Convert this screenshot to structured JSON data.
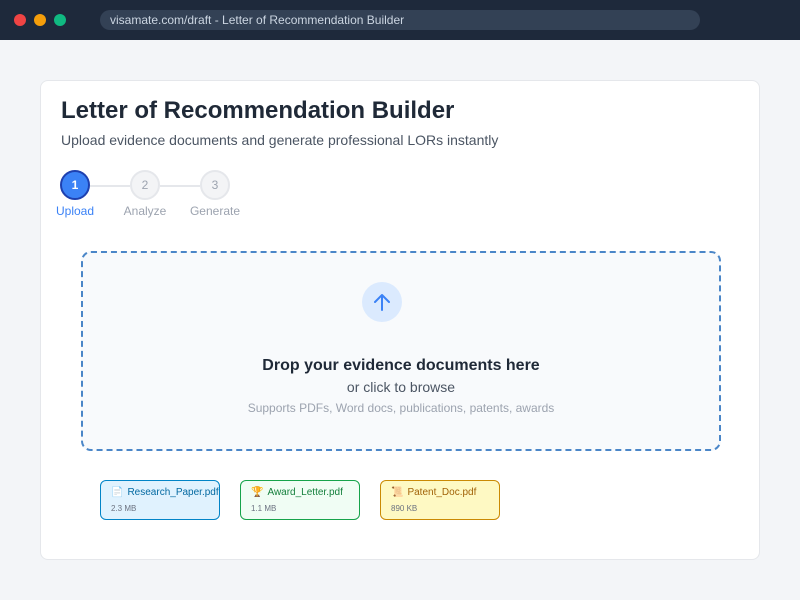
{
  "window": {
    "url": "visamate.com/draft - Letter of Recommendation Builder"
  },
  "page": {
    "title": "Letter of Recommendation Builder",
    "subtitle": "Upload evidence documents and generate professional LORs instantly"
  },
  "stepper": {
    "steps": [
      {
        "number": "1",
        "label": "Upload",
        "active": true
      },
      {
        "number": "2",
        "label": "Analyze",
        "active": false
      },
      {
        "number": "3",
        "label": "Generate",
        "active": false
      }
    ],
    "active_color": "#3b82f6"
  },
  "dropzone": {
    "icon": "upload-arrow-icon",
    "title": "Drop your evidence documents here",
    "browse": "or click to browse",
    "supported": "Supports PDFs, Word docs, publications, patents, awards",
    "border_color": "#4a86c8"
  },
  "files": [
    {
      "name": "Research_Paper.pdf",
      "size": "2.3 MB",
      "icon": "document-icon",
      "color": "#0284c7"
    },
    {
      "name": "Award_Letter.pdf",
      "size": "1.1 MB",
      "icon": "trophy-icon",
      "color": "#16a34a"
    },
    {
      "name": "Patent_Doc.pdf",
      "size": "890 KB",
      "icon": "scroll-icon",
      "color": "#ca8a04"
    }
  ]
}
